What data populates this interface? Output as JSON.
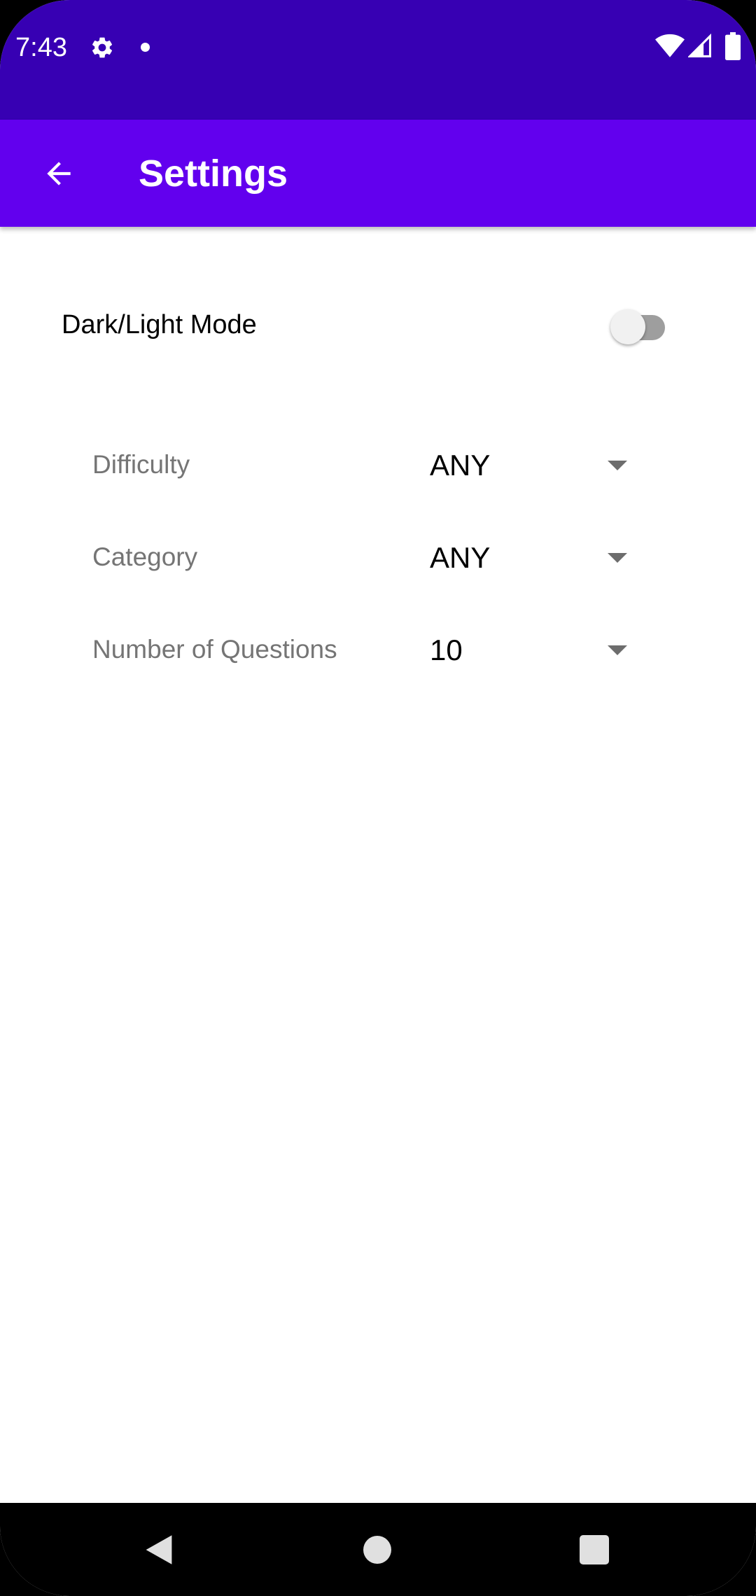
{
  "status_bar": {
    "time": "7:43",
    "icons": [
      "gear-icon",
      "notification-dot-icon",
      "wifi-icon",
      "signal-icon",
      "battery-icon"
    ],
    "background": "#3700b3"
  },
  "app_bar": {
    "title": "Settings",
    "back_icon": "arrow-back-icon",
    "background": "#6200ee"
  },
  "theme_toggle": {
    "label": "Dark/Light Mode",
    "checked": false
  },
  "settings": [
    {
      "label": "Difficulty",
      "value": "ANY"
    },
    {
      "label": "Category",
      "value": "ANY"
    },
    {
      "label": "Number of Questions",
      "value": "10"
    }
  ],
  "nav_bar": {
    "icons": [
      "nav-back-icon",
      "nav-home-icon",
      "nav-recents-icon"
    ]
  }
}
